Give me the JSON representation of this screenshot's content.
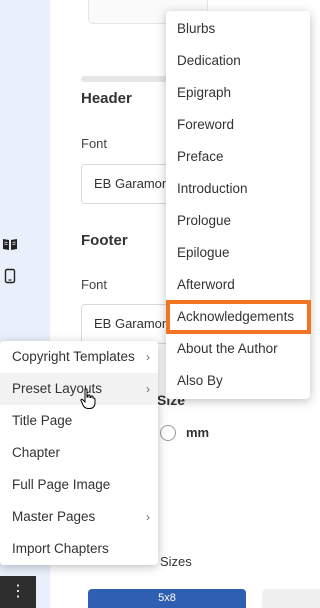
{
  "panel": {
    "header_title": "Header",
    "footer_title": "Footer",
    "font_label": "Font",
    "header_font_value": "EB Garamond",
    "footer_font_value": "EB Garamond",
    "trim_size_fragment": "Size",
    "unit_option": "mm",
    "sizes_fragment": "Sizes",
    "button_fragment": "5x8"
  },
  "sub_menu": {
    "items": [
      {
        "label": "Blurbs"
      },
      {
        "label": "Dedication"
      },
      {
        "label": "Epigraph"
      },
      {
        "label": "Foreword"
      },
      {
        "label": "Preface"
      },
      {
        "label": "Introduction"
      },
      {
        "label": "Prologue"
      },
      {
        "label": "Epilogue"
      },
      {
        "label": "Afterword"
      },
      {
        "label": "Acknowledgements"
      },
      {
        "label": "About the Author"
      },
      {
        "label": "Also By"
      }
    ],
    "highlighted": "Acknowledgements",
    "highlight_color": "#f07422"
  },
  "main_menu": {
    "items": [
      {
        "label": "Copyright Templates",
        "has_submenu": true
      },
      {
        "label": "Preset Layouts",
        "has_submenu": true
      },
      {
        "label": "Title Page",
        "has_submenu": false
      },
      {
        "label": "Chapter",
        "has_submenu": false
      },
      {
        "label": "Full Page Image",
        "has_submenu": false
      },
      {
        "label": "Master Pages",
        "has_submenu": true
      },
      {
        "label": "Import Chapters",
        "has_submenu": false
      }
    ],
    "active": "Preset Layouts"
  },
  "icons": {
    "chevron": "chevron-right-icon",
    "book": "book-icon",
    "phone": "device-icon",
    "more": "more-vertical-icon"
  },
  "colors": {
    "rail": "#e9f0fb",
    "accent_blue": "#2f5fb3"
  }
}
